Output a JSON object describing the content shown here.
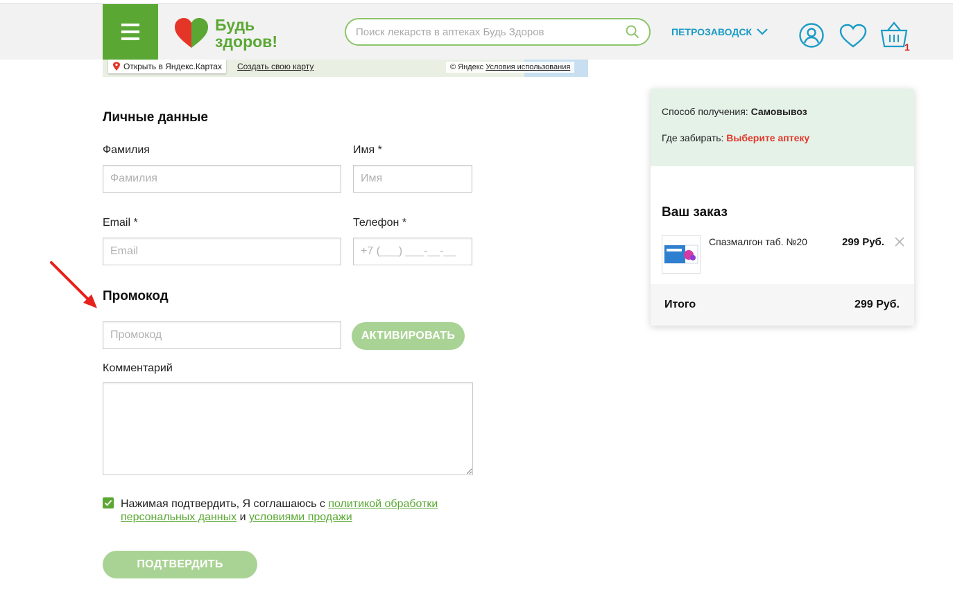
{
  "header": {
    "logo_line1": "Будь",
    "logo_line2": "здоров!",
    "search_placeholder": "Поиск лекарств в аптеках Будь Здоров",
    "city": "ПЕТРОЗАВОДСК",
    "cart_count": "1",
    "colors": {
      "brand_green": "#5aa833",
      "accent_blue": "#1a9bc6",
      "badge_red": "#d32020"
    }
  },
  "map": {
    "open_label": "Открыть в Яндекс.Картах",
    "create_link": "Создать свою карту",
    "copyright": "© Яндекс",
    "terms_link": "Условия использования"
  },
  "personal": {
    "title": "Личные данные",
    "surname_label": "Фамилия",
    "surname_placeholder": "Фамилия",
    "name_label": "Имя *",
    "name_placeholder": "Имя",
    "email_label": "Email *",
    "email_placeholder": "Email",
    "phone_label": "Телефон *",
    "phone_placeholder": "+7 (___) ___-__-__"
  },
  "promo": {
    "title": "Промокод",
    "placeholder": "Промокод",
    "activate_label": "АКТИВИРОВАТЬ"
  },
  "comment": {
    "label": "Комментарий",
    "value": ""
  },
  "consent": {
    "checked": true,
    "text_before": "Нажимая подтвердить, Я соглашаюсь с ",
    "privacy_link": "политикой обработки персональных данных",
    "text_middle": " и ",
    "terms_link": "условиями продажи"
  },
  "submit_label": "ПОДТВЕРДИТЬ",
  "order": {
    "method_label": "Способ получения:",
    "method_value": "Самовывоз",
    "pickup_label": "Где забирать:",
    "pickup_value": "Выберите аптеку",
    "title": "Ваш заказ",
    "items": [
      {
        "name": "Спазмалгон таб. №20",
        "price": "299 Руб."
      }
    ],
    "total_label": "Итого",
    "total_value": "299 Руб."
  }
}
